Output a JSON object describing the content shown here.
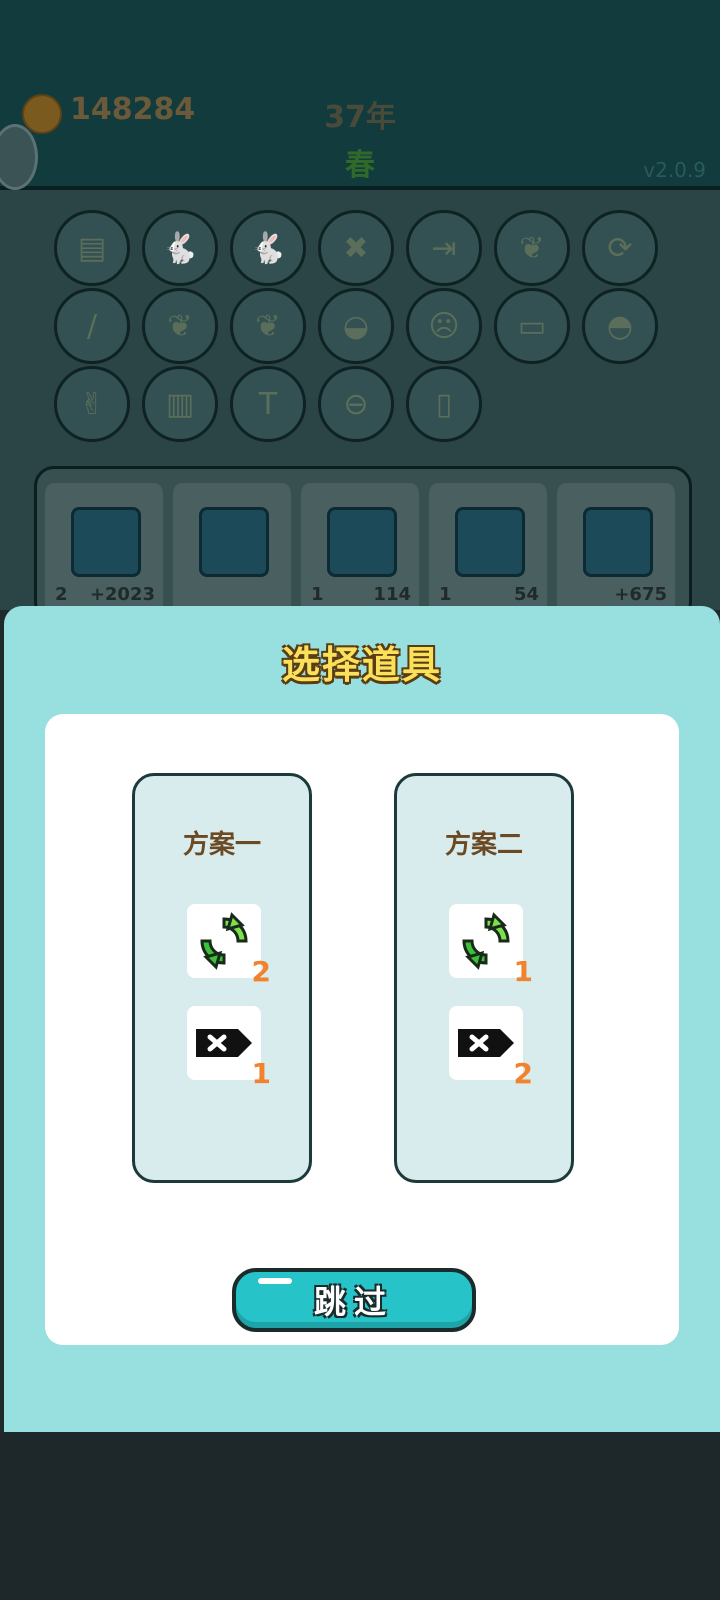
{
  "hud": {
    "coins": "148284",
    "year": "37年",
    "season": "春",
    "version": "v2.0.9"
  },
  "background_items": [
    {
      "name": "skirt-icon",
      "glyph": "▤"
    },
    {
      "name": "rabbit-icon",
      "glyph": "🐇"
    },
    {
      "name": "rabbit-icon",
      "glyph": "🐇"
    },
    {
      "name": "delete-tag-icon",
      "glyph": "✖"
    },
    {
      "name": "skip-icon",
      "glyph": "⇥"
    },
    {
      "name": "leaf-icon",
      "glyph": "❦"
    },
    {
      "name": "refresh-icon",
      "glyph": "⟳"
    },
    {
      "name": "screwdriver-icon",
      "glyph": "/"
    },
    {
      "name": "leaf-icon",
      "glyph": "❦"
    },
    {
      "name": "leaf-icon",
      "glyph": "❦"
    },
    {
      "name": "rice-bowl-icon",
      "glyph": "◒"
    },
    {
      "name": "face-icon",
      "glyph": "☹"
    },
    {
      "name": "printer-icon",
      "glyph": "▭"
    },
    {
      "name": "pot-icon",
      "glyph": "◓"
    },
    {
      "name": "rock-hand-icon",
      "glyph": "✌"
    },
    {
      "name": "bucket-icon",
      "glyph": "▥"
    },
    {
      "name": "hammer-icon",
      "glyph": "T"
    },
    {
      "name": "minus-icon",
      "glyph": "⊖"
    },
    {
      "name": "bottle-icon",
      "glyph": "▯"
    }
  ],
  "background_cards": [
    {
      "count": "2",
      "value": "+2023"
    },
    {
      "count": "",
      "value": ""
    },
    {
      "count": "1",
      "value": "114"
    },
    {
      "count": "1",
      "value": "54"
    },
    {
      "count": "",
      "value": "+675"
    }
  ],
  "modal": {
    "title": "选择道具",
    "plans": [
      {
        "title": "方案一",
        "refresh_count": "2",
        "remove_count": "1"
      },
      {
        "title": "方案二",
        "refresh_count": "1",
        "remove_count": "2"
      }
    ],
    "skip_label": "跳过"
  },
  "colors": {
    "modal_bg": "#98dfe0",
    "plan_card_bg": "#d8eced",
    "count_orange": "#f2822c",
    "title_yellow": "#fbe15a",
    "skip_button": "#26c3c9"
  }
}
